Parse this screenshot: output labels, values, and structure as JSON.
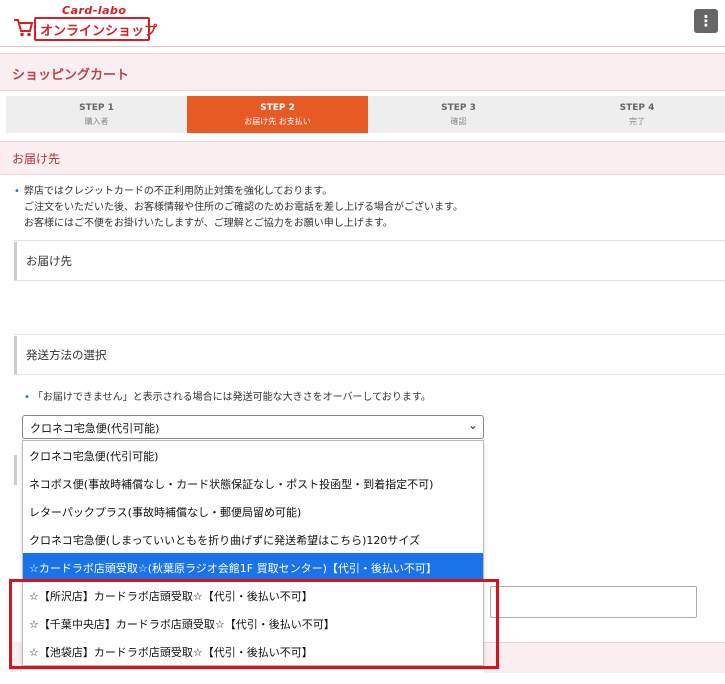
{
  "header": {
    "brand_top": "Card-labo",
    "brand_main": "オンラインショップ",
    "menu_icon": "⋮"
  },
  "cart_title": "ショッピングカート",
  "steps": [
    {
      "title": "STEP 1",
      "sub": "購入者"
    },
    {
      "title": "STEP 2",
      "sub": "お届け先 お支払い"
    },
    {
      "title": "STEP 3",
      "sub": "確認"
    },
    {
      "title": "STEP 4",
      "sub": "完了"
    }
  ],
  "delivery_title": "お届け先",
  "notice": {
    "line1": "弊店ではクレジットカードの不正利用防止対策を強化しております。",
    "line2": "ご注文をいただいた後、お客様情報や住所のご確認のためお電話を差し上げる場合がございます。",
    "line3": "お客様にはご不便をお掛けいたしますが、ご理解とご協力をお願い申し上げます。"
  },
  "delivery_sub": "お届け先",
  "shipping_title": "発送方法の選択",
  "shipping_note": "「お届けできません」と表示される場合には発送可能な大きさをオーバーしております。",
  "select": {
    "value": "クロネコ宅急便(代引可能)"
  },
  "options": [
    "クロネコ宅急便(代引可能)",
    "ネコポス便(事故時補償なし・カード状態保証なし・ポスト投函型・到着指定不可)",
    "レターパックプラス(事故時補償なし・郵便局留め可能)",
    "クロネコ宅急便(しまっていいともを折り曲げずに発送希望はこちら)120サイズ",
    "☆カードラボ店頭受取☆(秋葉原ラジオ会館1F 買取センター)【代引・後払い不可】",
    "☆【所沢店】カードラボ店頭受取☆【代引・後払い不可】",
    "☆【千葉中央店】カードラボ店頭受取☆【代引・後払い不可】",
    "☆【池袋店】カードラボ店頭受取☆【代引・後払い不可】"
  ],
  "selected_option_index": 4,
  "colors": {
    "accent": "#e85a24",
    "brand_red": "#d31f26",
    "highlight": "#1a73e8",
    "annotation": "#d4141f"
  }
}
